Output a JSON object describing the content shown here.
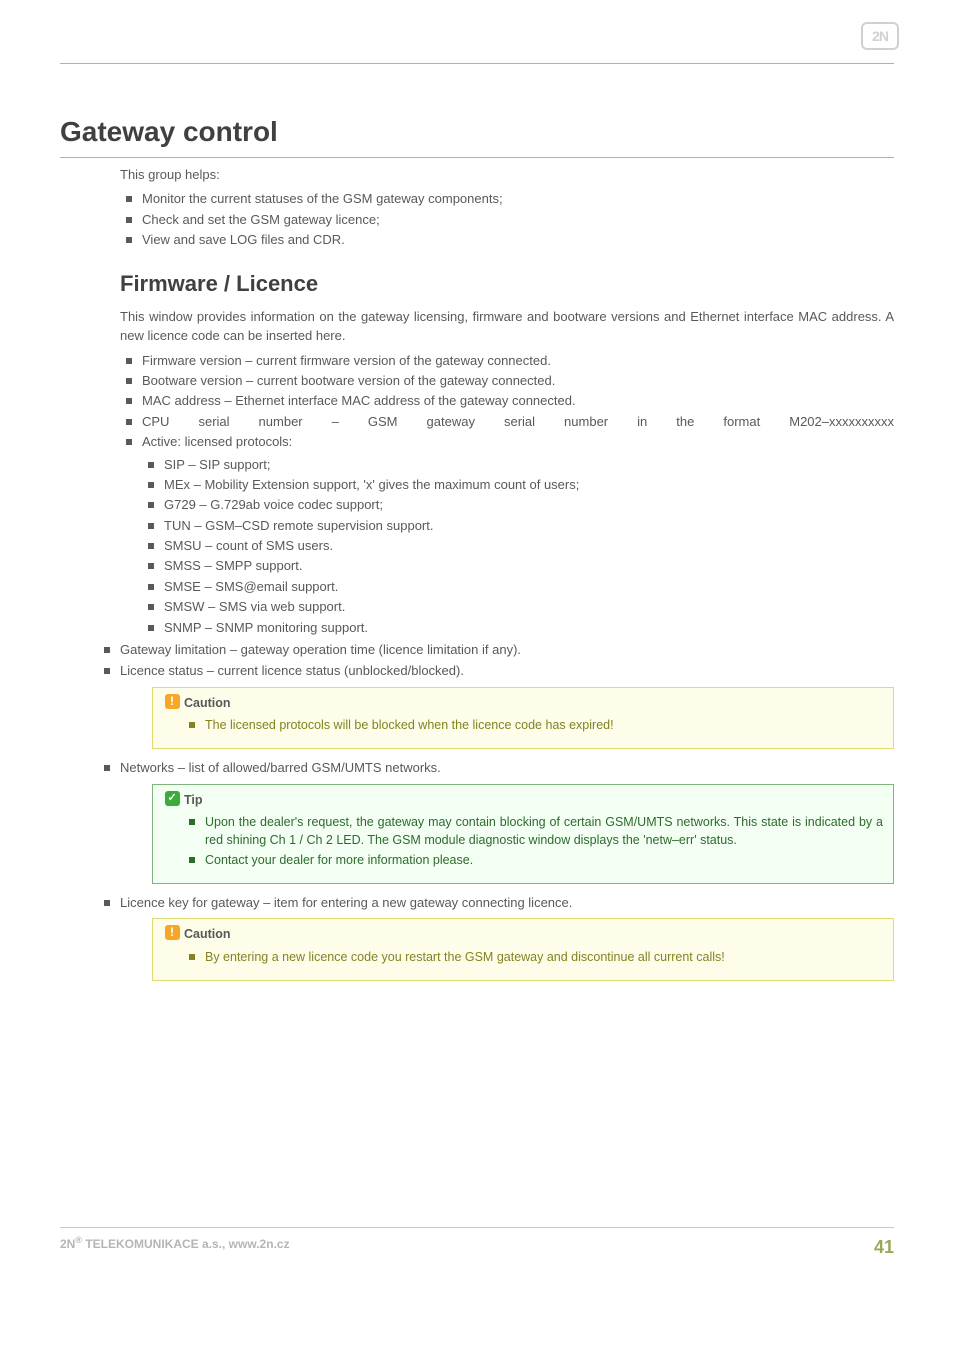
{
  "logo_text": "2N",
  "h1": "Gateway control",
  "intro1": "This group helps:",
  "intro_bullets": [
    "Monitor the current statuses of the GSM gateway components;",
    "Check and set the GSM gateway licence;",
    "View and save LOG files and CDR."
  ],
  "h2": "Firmware / Licence",
  "fw_intro": "This window provides information on the gateway licensing, firmware and bootware versions and Ethernet interface MAC address. A new licence code can be inserted here.",
  "fw_bullets": [
    "Firmware version – current firmware version of the gateway connected.",
    "Bootware version – current bootware version of the gateway connected.",
    "MAC address – Ethernet interface MAC address of the gateway connected.",
    "CPU serial number – GSM gateway serial number in the format M202–xxxxxxxxxx",
    "Active: licensed protocols:"
  ],
  "active_sub": [
    "SIP – SIP support;",
    "MEx – Mobility Extension support, 'x' gives the maximum count of users;",
    "G729 – G.729ab voice codec support;",
    "TUN – GSM–CSD remote supervision support.",
    "SMSU – count of SMS users.",
    "SMSS – SMPP support.",
    "SMSE – SMS@email support.",
    "SMSW – SMS via web support.",
    "SNMP – SNMP monitoring support."
  ],
  "after_active": [
    "Gateway limitation – gateway operation time (licence limitation if any).",
    "Licence status – current licence status (unblocked/blocked)."
  ],
  "caution1_title": "Caution",
  "caution1_body": "The licensed protocols will be blocked when the licence code has expired!",
  "networks_bullet": "Networks – list of allowed/barred GSM/UMTS networks.",
  "tip_title": "Tip",
  "tip_b1": "Upon the dealer's request, the gateway may contain blocking of certain GSM/UMTS networks. This state is indicated by a red shining Ch 1 / Ch 2 LED. The GSM module diagnostic window displays the 'netw–err' status.",
  "tip_b2": "Contact your dealer for more information please.",
  "licence_key_bullet": "Licence key for gateway – item for entering a new gateway connecting licence.",
  "caution2_title": "Caution",
  "caution2_body": "By entering a new licence code you restart the GSM gateway and discontinue all current calls!",
  "footer_left_prefix": "2N",
  "footer_left_sup": "®",
  "footer_left_rest": " TELEKOMUNIKACE a.s., www.2n.cz",
  "footer_page": "41"
}
